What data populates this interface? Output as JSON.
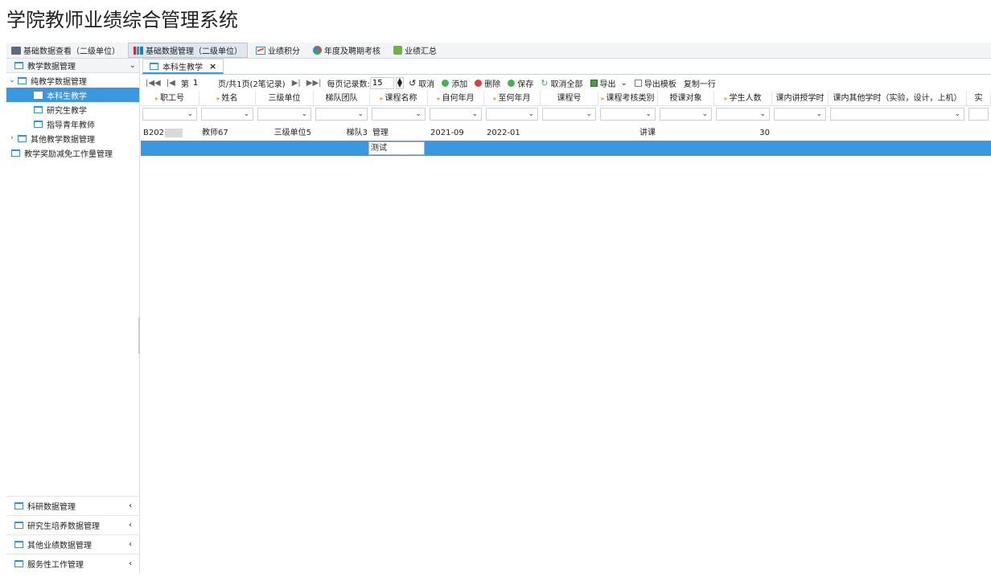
{
  "app_title": "学院教师业绩综合管理系统",
  "top_menu": [
    {
      "label": "基础数据查看（二级单位）",
      "icon": "database-icon",
      "active": false
    },
    {
      "label": "基础数据管理（二级单位）",
      "icon": "bar-chart-icon",
      "active": true
    },
    {
      "label": "业绩积分",
      "icon": "line-chart-icon",
      "active": false
    },
    {
      "label": "年度及聘期考核",
      "icon": "pie-chart-icon",
      "active": false
    },
    {
      "label": "业绩汇总",
      "icon": "puzzle-icon",
      "active": false
    }
  ],
  "sidebar": {
    "header": "教学数据管理",
    "tree": [
      {
        "label": "纯教学数据管理",
        "toggle": "⌄"
      },
      {
        "label": "本科生教学"
      },
      {
        "label": "研究生教学"
      },
      {
        "label": "指导青年教师"
      },
      {
        "label": "其他教学数据管理",
        "toggle": "›"
      },
      {
        "label": "教学奖励减免工作量管理"
      }
    ],
    "bottom": [
      {
        "label": "科研数据管理"
      },
      {
        "label": "研究生培养数据管理"
      },
      {
        "label": "其他业绩数据管理"
      },
      {
        "label": "服务性工作管理"
      }
    ],
    "collapse_glyph": "‹"
  },
  "tab": {
    "label": "本科生教学",
    "close": "×"
  },
  "toolbar": {
    "page_prefix": "第",
    "page_value": "1",
    "page_info": "页/共1页(2笔记录)",
    "per_page_label": "每页记录数:",
    "per_page_value": "15",
    "cancel": "取消",
    "add": "添加",
    "delete": "删除",
    "save": "保存",
    "cancel_all": "取消全部",
    "export": "导出",
    "export_template": "导出模板",
    "copy_row": "复制一行"
  },
  "grid": {
    "columns": [
      {
        "label": "职工号",
        "req": true
      },
      {
        "label": "姓名",
        "req": true
      },
      {
        "label": "三级单位",
        "req": false
      },
      {
        "label": "梯队团队",
        "req": false
      },
      {
        "label": "课程名称",
        "req": true
      },
      {
        "label": "自何年月",
        "req": true
      },
      {
        "label": "至何年月",
        "req": true
      },
      {
        "label": "课程号",
        "req": false
      },
      {
        "label": "课程考核类别",
        "req": true
      },
      {
        "label": "授课对象",
        "req": false
      },
      {
        "label": "学生人数",
        "req": true
      },
      {
        "label": "课内讲授学时",
        "req": false
      },
      {
        "label": "课内其他学时（实验，设计，上机）",
        "req": false
      },
      {
        "label": "实",
        "req": false
      }
    ],
    "rows": [
      [
        "B202",
        "教师67",
        "三级单位5",
        "梯队3",
        "管理",
        "2021-09",
        "2022-01",
        "",
        "讲课",
        "",
        "30",
        "",
        "",
        ""
      ]
    ],
    "editing_value": "测试"
  }
}
